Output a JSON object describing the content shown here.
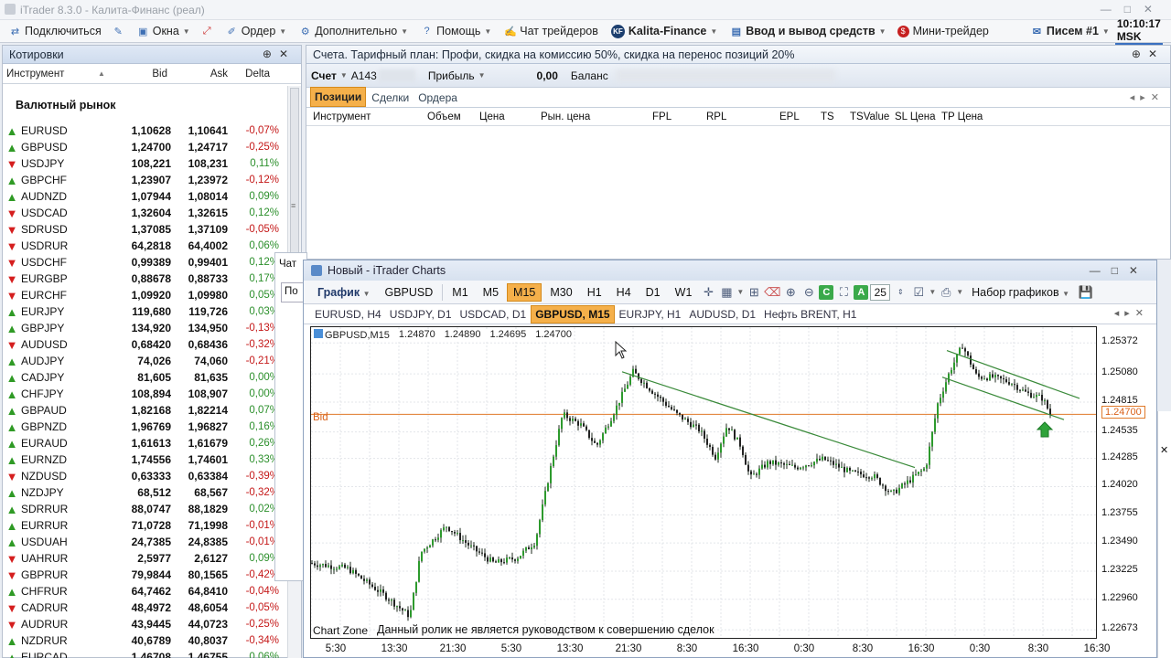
{
  "window": {
    "title": "iTrader 8.3.0 - Калита-Финанс (реал)"
  },
  "menu": {
    "connect": "Подключиться",
    "windows": "Окна",
    "order": "Ордер",
    "extra": "Дополнительно",
    "help": "Помощь",
    "chat": "Чат трейдеров",
    "kf_badge": "KF",
    "kalita": "Kalita-Finance",
    "deposit": "Ввод и вывод средств",
    "mini": "Мини-трейдер",
    "mail": "Писем #1",
    "clock": "10:10:17 MSK"
  },
  "quotes": {
    "title": "Котировки",
    "col_instrument": "Инструмент",
    "col_bid": "Bid",
    "col_ask": "Ask",
    "col_delta": "Delta",
    "group": "Валютный рынок",
    "rows": [
      {
        "sym": "EURUSD",
        "bid": "1,10628",
        "ask": "1,10641",
        "delta": "-0,07%",
        "dir": "up"
      },
      {
        "sym": "GBPUSD",
        "bid": "1,24700",
        "ask": "1,24717",
        "delta": "-0,25%",
        "dir": "up"
      },
      {
        "sym": "USDJPY",
        "bid": "108,221",
        "ask": "108,231",
        "delta": "0,11%",
        "dir": "dn"
      },
      {
        "sym": "GBPCHF",
        "bid": "1,23907",
        "ask": "1,23972",
        "delta": "-0,12%",
        "dir": "up"
      },
      {
        "sym": "AUDNZD",
        "bid": "1,07944",
        "ask": "1,08014",
        "delta": "0,09%",
        "dir": "up"
      },
      {
        "sym": "USDCAD",
        "bid": "1,32604",
        "ask": "1,32615",
        "delta": "0,12%",
        "dir": "dn"
      },
      {
        "sym": "SDRUSD",
        "bid": "1,37085",
        "ask": "1,37109",
        "delta": "-0,05%",
        "dir": "dn"
      },
      {
        "sym": "USDRUR",
        "bid": "64,2818",
        "ask": "64,4002",
        "delta": "0,06%",
        "dir": "dn"
      },
      {
        "sym": "USDCHF",
        "bid": "0,99389",
        "ask": "0,99401",
        "delta": "0,12%",
        "dir": "dn"
      },
      {
        "sym": "EURGBP",
        "bid": "0,88678",
        "ask": "0,88733",
        "delta": "0,17%",
        "dir": "dn"
      },
      {
        "sym": "EURCHF",
        "bid": "1,09920",
        "ask": "1,09980",
        "delta": "0,05%",
        "dir": "dn"
      },
      {
        "sym": "EURJPY",
        "bid": "119,680",
        "ask": "119,726",
        "delta": "0,03%",
        "dir": "up"
      },
      {
        "sym": "GBPJPY",
        "bid": "134,920",
        "ask": "134,950",
        "delta": "-0,13%",
        "dir": "up"
      },
      {
        "sym": "AUDUSD",
        "bid": "0,68420",
        "ask": "0,68436",
        "delta": "-0,32%",
        "dir": "dn"
      },
      {
        "sym": "AUDJPY",
        "bid": "74,026",
        "ask": "74,060",
        "delta": "-0,21%",
        "dir": "up"
      },
      {
        "sym": "CADJPY",
        "bid": "81,605",
        "ask": "81,635",
        "delta": "0,00%",
        "dir": "up"
      },
      {
        "sym": "CHFJPY",
        "bid": "108,894",
        "ask": "108,907",
        "delta": "0,00%",
        "dir": "up"
      },
      {
        "sym": "GBPAUD",
        "bid": "1,82168",
        "ask": "1,82214",
        "delta": "0,07%",
        "dir": "up"
      },
      {
        "sym": "GBPNZD",
        "bid": "1,96769",
        "ask": "1,96827",
        "delta": "0,16%",
        "dir": "up"
      },
      {
        "sym": "EURAUD",
        "bid": "1,61613",
        "ask": "1,61679",
        "delta": "0,26%",
        "dir": "up"
      },
      {
        "sym": "EURNZD",
        "bid": "1,74556",
        "ask": "1,74601",
        "delta": "0,33%",
        "dir": "up"
      },
      {
        "sym": "NZDUSD",
        "bid": "0,63333",
        "ask": "0,63384",
        "delta": "-0,39%",
        "dir": "dn"
      },
      {
        "sym": "NZDJPY",
        "bid": "68,512",
        "ask": "68,567",
        "delta": "-0,32%",
        "dir": "up"
      },
      {
        "sym": "SDRRUR",
        "bid": "88,0747",
        "ask": "88,1829",
        "delta": "0,02%",
        "dir": "up"
      },
      {
        "sym": "EURRUR",
        "bid": "71,0728",
        "ask": "71,1998",
        "delta": "-0,01%",
        "dir": "up"
      },
      {
        "sym": "USDUAH",
        "bid": "24,7385",
        "ask": "24,8385",
        "delta": "-0,01%",
        "dir": "up"
      },
      {
        "sym": "UAHRUR",
        "bid": "2,5977",
        "ask": "2,6127",
        "delta": "0,09%",
        "dir": "dn"
      },
      {
        "sym": "GBPRUR",
        "bid": "79,9844",
        "ask": "80,1565",
        "delta": "-0,42%",
        "dir": "dn"
      },
      {
        "sym": "CHFRUR",
        "bid": "64,7462",
        "ask": "64,8410",
        "delta": "-0,04%",
        "dir": "up"
      },
      {
        "sym": "CADRUR",
        "bid": "48,4972",
        "ask": "48,6054",
        "delta": "-0,05%",
        "dir": "dn"
      },
      {
        "sym": "AUDRUR",
        "bid": "43,9445",
        "ask": "44,0723",
        "delta": "-0,25%",
        "dir": "dn"
      },
      {
        "sym": "NZDRUR",
        "bid": "40,6789",
        "ask": "40,8037",
        "delta": "-0,34%",
        "dir": "up"
      },
      {
        "sym": "EURCAD",
        "bid": "1,46708",
        "ask": "1,46755",
        "delta": "0,06%",
        "dir": "up"
      }
    ]
  },
  "accounts": {
    "title": "Счета. Тарифный план: Профи, скидка на комиссию 50%, скидка на перенос позиций 20%",
    "account_label": "Счет",
    "account_value": "A143",
    "profit_label": "Прибыль",
    "profit_value": "0,00",
    "balance_label": "Баланс",
    "tabs": [
      "Позиции",
      "Сделки",
      "Ордера"
    ],
    "columns": [
      "Инструмент",
      "Объем",
      "Цена",
      "Рын. цена",
      "FPL",
      "RPL",
      "EPL",
      "TS",
      "TSValue",
      "SL Цена",
      "TP Цена"
    ]
  },
  "behind": {
    "chat": "Чат",
    "field": "По"
  },
  "charts": {
    "title": "Новый - iTrader Charts",
    "graph_menu": "График",
    "symbol": "GBPUSD",
    "timeframes": [
      "M1",
      "M5",
      "M15",
      "M30",
      "H1",
      "H4",
      "D1",
      "W1"
    ],
    "active_timeframe": "M15",
    "zoom": "25",
    "sets": "Набор графиков",
    "icon_c": "C",
    "icon_a": "A",
    "tabs": [
      "EURUSD, H4",
      "USDJPY, D1",
      "USDCAD, D1",
      "GBPUSD, M15",
      "EURJPY, H1",
      "AUDUSD, D1",
      "Нефть BRENT, H1"
    ],
    "active_tab": "GBPUSD, M15",
    "info": {
      "name": "GBPUSD,M15",
      "o": "1.24870",
      "h": "1.24890",
      "l": "1.24695",
      "c": "1.24700"
    },
    "bid_label": "Bid",
    "bid_tag": "1.24700",
    "zone_label": "Chart Zone",
    "disclaimer": "Данный ролик не является руководством к совершению сделок"
  },
  "chart_data": {
    "type": "line",
    "title": "",
    "symbol": "GBPUSD,M15",
    "y_ticks": [
      "1.25372",
      "1.25080",
      "1.24815",
      "1.24535",
      "1.24285",
      "1.24020",
      "1.23755",
      "1.23490",
      "1.23225",
      "1.22960",
      "1.22673"
    ],
    "x_ticks": [
      "5:30",
      "13:30",
      "21:30",
      "5:30",
      "13:30",
      "21:30",
      "8:30",
      "16:30",
      "0:30",
      "8:30",
      "16:30",
      "0:30",
      "8:30",
      "16:30"
    ],
    "ylim": [
      1.2258,
      1.2552
    ],
    "bid": 1.247,
    "grid": true,
    "price_path": [
      [
        0,
        1.233
      ],
      [
        40,
        1.2325
      ],
      [
        80,
        1.23
      ],
      [
        108,
        1.228
      ],
      [
        120,
        1.234
      ],
      [
        148,
        1.2365
      ],
      [
        175,
        1.2345
      ],
      [
        200,
        1.233
      ],
      [
        225,
        1.2335
      ],
      [
        245,
        1.235
      ],
      [
        262,
        1.242
      ],
      [
        275,
        1.247
      ],
      [
        295,
        1.246
      ],
      [
        312,
        1.244
      ],
      [
        330,
        1.247
      ],
      [
        352,
        1.251
      ],
      [
        375,
        1.249
      ],
      [
        400,
        1.247
      ],
      [
        425,
        1.2455
      ],
      [
        442,
        1.243
      ],
      [
        455,
        1.246
      ],
      [
        470,
        1.244
      ],
      [
        480,
        1.241
      ],
      [
        500,
        1.2425
      ],
      [
        530,
        1.242
      ],
      [
        560,
        1.2428
      ],
      [
        590,
        1.2415
      ],
      [
        615,
        1.2412
      ],
      [
        635,
        1.2395
      ],
      [
        650,
        1.2405
      ],
      [
        672,
        1.242
      ],
      [
        685,
        1.248
      ],
      [
        698,
        1.251
      ],
      [
        712,
        1.2535
      ],
      [
        728,
        1.2505
      ],
      [
        745,
        1.2505
      ],
      [
        765,
        1.25
      ],
      [
        782,
        1.249
      ],
      [
        800,
        1.2485
      ],
      [
        808,
        1.247
      ]
    ],
    "trendlines": [
      {
        "from": [
          340,
          1.251
        ],
        "to": [
          660,
          1.242
        ]
      },
      {
        "from": [
          695,
          1.253
        ],
        "to": [
          840,
          1.2485
        ]
      },
      {
        "from": [
          690,
          1.2505
        ],
        "to": [
          823,
          1.2465
        ]
      }
    ]
  }
}
